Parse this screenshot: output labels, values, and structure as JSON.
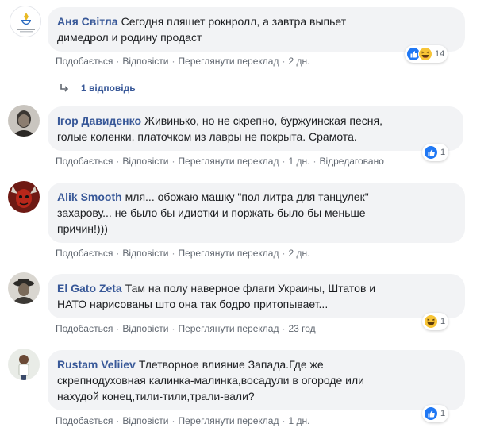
{
  "actions": {
    "like": "Подобається",
    "reply": "Відповісти",
    "translate": "Переглянути переклад",
    "sep": "·"
  },
  "comments": [
    {
      "author": "Аня Світла",
      "text_line1": "Сегодня пляшет рокнролл, а завтра выпьет",
      "text_line2": "димедрол и родину продаст",
      "time": "2 дн.",
      "reaction_count": "14",
      "reactions": [
        "like-icon",
        "haha-icon"
      ],
      "replies_label": "1 відповідь"
    },
    {
      "author": "Ігор Давиденко",
      "text_line1": "Живинько, но не скрепно, буржуинская песня,",
      "text_line2": "голые коленки, платочком из лавры не покрыта. Срамота.",
      "time": "1 дн.",
      "edited": "Відредаговано",
      "reaction_count": "1",
      "reactions": [
        "like-icon"
      ]
    },
    {
      "author": "Alik Smooth",
      "text_line1": "мля... обожаю машку \"пол литра для танцулек\"",
      "text_line2": "захарову... не было бы идиотки и поржать было бы меньше",
      "text_line3": "причин!)))",
      "time": "2 дн."
    },
    {
      "author": "El Gato Zeta",
      "text_line1": "Там на полу наверное флаги Украины, Штатов и",
      "text_line2": "НАТО нарисованы што она так бодро притопывает...",
      "time": "23 год",
      "reaction_count": "1",
      "reactions": [
        "haha-icon"
      ]
    },
    {
      "author": "Rustam Veliiev",
      "text_line1": "Тлетворное влияние Запада.Где же",
      "text_line2": "скрепнодуховная калинка-малинка,восадули в огороде или",
      "text_line3": "нахудой конец,тили-тили,трали-вали?",
      "time": "1 дн.",
      "reaction_count": "1",
      "reactions": [
        "like-icon"
      ]
    }
  ],
  "colors": {
    "link": "#385898",
    "bubble": "#f2f3f5",
    "meta": "#606770",
    "like_blue": "#2078f4",
    "haha_yellow": "#f7c436"
  }
}
